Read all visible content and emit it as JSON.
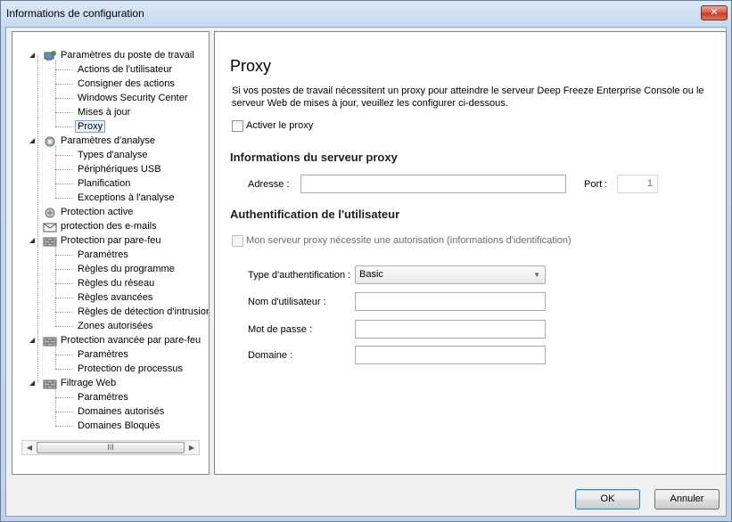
{
  "window": {
    "title": "Informations de configuration",
    "close_label": "✕"
  },
  "tree": {
    "items": [
      {
        "label": "Paramètres du poste de travail",
        "level": 0,
        "icon": "workstation-icon"
      },
      {
        "label": "Actions de l'utilisateur",
        "level": 1
      },
      {
        "label": "Consigner des actions",
        "level": 1
      },
      {
        "label": "Windows Security Center",
        "level": 1
      },
      {
        "label": "Mises à jour",
        "level": 1
      },
      {
        "label": "Proxy",
        "level": 1,
        "selected": true
      },
      {
        "label": "Paramètres d'analyse",
        "level": 0,
        "icon": "scan-settings-icon"
      },
      {
        "label": "Types d'analyse",
        "level": 1
      },
      {
        "label": "Périphériques USB",
        "level": 1
      },
      {
        "label": "Planification",
        "level": 1
      },
      {
        "label": "Exceptions à l'analyse",
        "level": 1
      },
      {
        "label": "Protection active",
        "level": 0,
        "icon": "active-protection-icon",
        "leaf": true
      },
      {
        "label": "protection des e-mails",
        "level": 0,
        "icon": "email-icon",
        "leaf": true
      },
      {
        "label": "Protection par pare-feu",
        "level": 0,
        "icon": "firewall-icon"
      },
      {
        "label": "Paramètres",
        "level": 1
      },
      {
        "label": "Règles du programme",
        "level": 1
      },
      {
        "label": "Règles du réseau",
        "level": 1
      },
      {
        "label": "Règles avancées",
        "level": 1
      },
      {
        "label": "Règles de détection d'intrusion",
        "level": 1
      },
      {
        "label": "Zones autorisées",
        "level": 1
      },
      {
        "label": "Protection avancée par pare-feu",
        "level": 0,
        "icon": "firewall-icon"
      },
      {
        "label": "Paramètres",
        "level": 1
      },
      {
        "label": "Protection de processus",
        "level": 1
      },
      {
        "label": "Filtrage Web",
        "level": 0,
        "icon": "web-filter-icon"
      },
      {
        "label": "Paramètres",
        "level": 1
      },
      {
        "label": "Domaines autorisés",
        "level": 1
      },
      {
        "label": "Domaines Bloqués",
        "level": 1
      }
    ],
    "scrollbar_thumb_label": "III"
  },
  "main": {
    "heading": "Proxy",
    "description": "Si vos postes de travail nécessitent un proxy pour atteindre le serveur Deep Freeze Enterprise Console ou le serveur Web de mises à jour, veuillez les configurer ci-dessous.",
    "enable_proxy_label": "Activer le proxy",
    "enable_proxy_checked": false,
    "server_section_title": "Informations du serveur proxy",
    "address_label": "Adresse :",
    "address_value": "",
    "port_label": "Port :",
    "port_value": "1",
    "auth_section_title": "Authentification de l'utilisateur",
    "requires_auth_label": "Mon serveur proxy nécessite une autorisation (informations d'identification)",
    "requires_auth_checked": false,
    "auth_type_label": "Type d'authentification :",
    "auth_type_value": "Basic",
    "username_label": "Nom d'utilisateur :",
    "username_value": "",
    "password_label": "Mot de passe :",
    "password_value": "",
    "domain_label": "Domaine :",
    "domain_value": ""
  },
  "footer": {
    "ok_label": "OK",
    "cancel_label": "Annuler"
  }
}
